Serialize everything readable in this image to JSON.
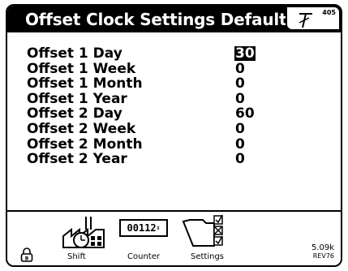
{
  "header": {
    "title": "Offset Clock Settings Defaults",
    "page_number": "405",
    "signal_icon": "antenna-icon"
  },
  "settings": [
    {
      "label": "Offset 1 Day",
      "value": "30",
      "selected": true
    },
    {
      "label": "Offset 1 Week",
      "value": "0"
    },
    {
      "label": "Offset 1 Month",
      "value": "0"
    },
    {
      "label": "Offset 1 Year",
      "value": "0"
    },
    {
      "label": "Offset 2 Day",
      "value": "60"
    },
    {
      "label": "Offset 2 Week",
      "value": "0"
    },
    {
      "label": "Offset 2 Month",
      "value": "0"
    },
    {
      "label": "Offset 2 Year",
      "value": "0"
    }
  ],
  "bottom_bar": {
    "lock_icon": "lock-icon",
    "tabs": [
      {
        "label": "Shift",
        "icon": "factory-clock-icon"
      },
      {
        "label": "Counter",
        "icon": "counter-icon",
        "display": "00112"
      },
      {
        "label": "Settings",
        "icon": "settings-folder-icon"
      }
    ],
    "version": "5.09k",
    "revision": "REV76"
  }
}
